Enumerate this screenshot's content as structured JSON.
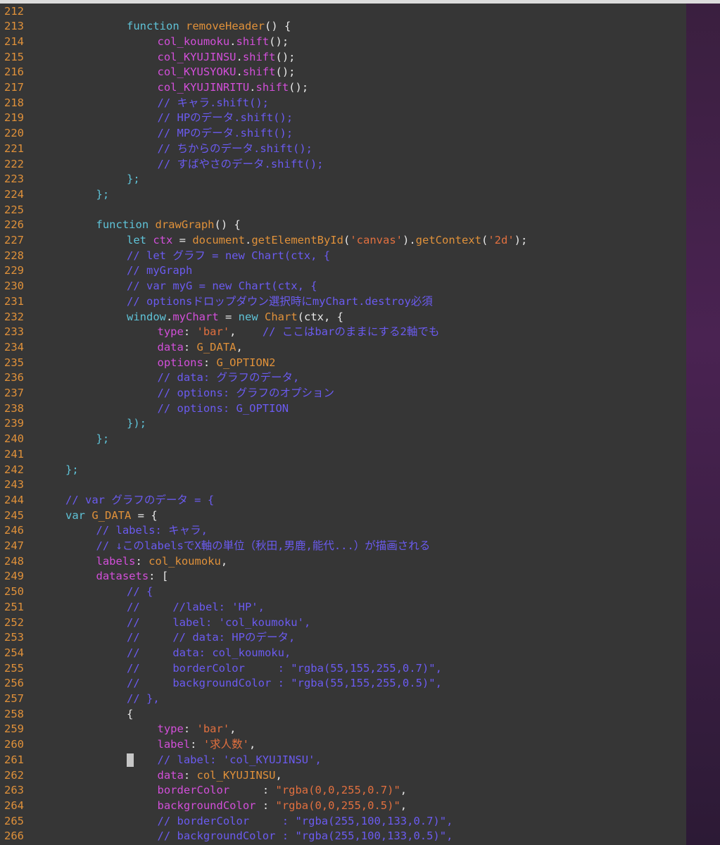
{
  "editor": {
    "language": "javascript",
    "lines": [
      {
        "num": "212",
        "indent": 0,
        "tokens": []
      },
      {
        "num": "213",
        "indent": 4,
        "tokens": [
          [
            "kw",
            "function "
          ],
          [
            "fn",
            "removeHeader"
          ],
          [
            "pun",
            "() {"
          ]
        ]
      },
      {
        "num": "214",
        "indent": 5,
        "tokens": [
          [
            "prop",
            "col_koumoku"
          ],
          [
            "pun",
            "."
          ],
          [
            "prop",
            "shift"
          ],
          [
            "pun",
            "();"
          ]
        ]
      },
      {
        "num": "215",
        "indent": 5,
        "tokens": [
          [
            "prop",
            "col_KYUJINSU"
          ],
          [
            "pun",
            "."
          ],
          [
            "prop",
            "shift"
          ],
          [
            "pun",
            "();"
          ]
        ]
      },
      {
        "num": "216",
        "indent": 5,
        "tokens": [
          [
            "prop",
            "col_KYUSYOKU"
          ],
          [
            "pun",
            "."
          ],
          [
            "prop",
            "shift"
          ],
          [
            "pun",
            "();"
          ]
        ]
      },
      {
        "num": "217",
        "indent": 5,
        "tokens": [
          [
            "prop",
            "col_KYUJINRITU"
          ],
          [
            "pun",
            "."
          ],
          [
            "prop",
            "shift"
          ],
          [
            "pun",
            "();"
          ]
        ]
      },
      {
        "num": "218",
        "indent": 5,
        "tokens": [
          [
            "cm",
            "// キャラ.shift();"
          ]
        ]
      },
      {
        "num": "219",
        "indent": 5,
        "tokens": [
          [
            "cm",
            "// HPのデータ.shift();"
          ]
        ]
      },
      {
        "num": "220",
        "indent": 5,
        "tokens": [
          [
            "cm",
            "// MPのデータ.shift();"
          ]
        ]
      },
      {
        "num": "221",
        "indent": 5,
        "tokens": [
          [
            "cm",
            "// ちからのデータ.shift();"
          ]
        ]
      },
      {
        "num": "222",
        "indent": 5,
        "tokens": [
          [
            "cm",
            "// すばやさのデータ.shift();"
          ]
        ]
      },
      {
        "num": "223",
        "indent": 4,
        "tokens": [
          [
            "kw",
            "};"
          ]
        ]
      },
      {
        "num": "224",
        "indent": 3,
        "tokens": [
          [
            "kw",
            "};"
          ]
        ]
      },
      {
        "num": "225",
        "indent": 0,
        "tokens": []
      },
      {
        "num": "226",
        "indent": 3,
        "tokens": [
          [
            "kw",
            "function "
          ],
          [
            "fn",
            "drawGraph"
          ],
          [
            "pun",
            "() {"
          ]
        ]
      },
      {
        "num": "227",
        "indent": 4,
        "tokens": [
          [
            "kw",
            "let "
          ],
          [
            "prop",
            "ctx"
          ],
          [
            "pun",
            " = "
          ],
          [
            "fn",
            "document"
          ],
          [
            "pun",
            "."
          ],
          [
            "fn",
            "getElementById"
          ],
          [
            "pun",
            "("
          ],
          [
            "str",
            "'canvas'"
          ],
          [
            "pun",
            ")."
          ],
          [
            "fn",
            "getContext"
          ],
          [
            "pun",
            "("
          ],
          [
            "str",
            "'2d'"
          ],
          [
            "pun",
            ");"
          ]
        ]
      },
      {
        "num": "228",
        "indent": 4,
        "tokens": [
          [
            "cm",
            "// let グラフ = new Chart(ctx, {"
          ]
        ]
      },
      {
        "num": "229",
        "indent": 4,
        "tokens": [
          [
            "cm",
            "// myGraph"
          ]
        ]
      },
      {
        "num": "230",
        "indent": 4,
        "tokens": [
          [
            "cm",
            "// var myG = new Chart(ctx, {"
          ]
        ]
      },
      {
        "num": "231",
        "indent": 4,
        "tokens": [
          [
            "cm",
            "// optionsドロップダウン選択時にmyChart.destroy必須"
          ]
        ]
      },
      {
        "num": "232",
        "indent": 4,
        "tokens": [
          [
            "kw",
            "window"
          ],
          [
            "pun",
            "."
          ],
          [
            "prop",
            "myChart"
          ],
          [
            "pun",
            " = "
          ],
          [
            "kw",
            "new "
          ],
          [
            "fn",
            "Chart"
          ],
          [
            "pun",
            "(ctx, {"
          ]
        ]
      },
      {
        "num": "233",
        "indent": 5,
        "tokens": [
          [
            "prop",
            "type"
          ],
          [
            "pun",
            ": "
          ],
          [
            "str",
            "'bar'"
          ],
          [
            "pun",
            ",    "
          ],
          [
            "cm",
            "// ここはbarのままにする2軸でも"
          ]
        ]
      },
      {
        "num": "234",
        "indent": 5,
        "tokens": [
          [
            "prop",
            "data"
          ],
          [
            "pun",
            ": "
          ],
          [
            "txt",
            "G_DATA"
          ],
          [
            "pun",
            ","
          ]
        ]
      },
      {
        "num": "235",
        "indent": 5,
        "tokens": [
          [
            "prop",
            "options"
          ],
          [
            "pun",
            ": "
          ],
          [
            "txt",
            "G_OPTION2"
          ]
        ]
      },
      {
        "num": "236",
        "indent": 5,
        "tokens": [
          [
            "cm",
            "// data: グラフのデータ,"
          ]
        ]
      },
      {
        "num": "237",
        "indent": 5,
        "tokens": [
          [
            "cm",
            "// options: グラフのオプション"
          ]
        ]
      },
      {
        "num": "238",
        "indent": 5,
        "tokens": [
          [
            "cm",
            "// options: G_OPTION"
          ]
        ]
      },
      {
        "num": "239",
        "indent": 4,
        "tokens": [
          [
            "kw",
            "});"
          ]
        ]
      },
      {
        "num": "240",
        "indent": 3,
        "tokens": [
          [
            "kw",
            "};"
          ]
        ]
      },
      {
        "num": "241",
        "indent": 0,
        "tokens": []
      },
      {
        "num": "242",
        "indent": 2,
        "tokens": [
          [
            "kw",
            "};"
          ]
        ]
      },
      {
        "num": "243",
        "indent": 0,
        "tokens": []
      },
      {
        "num": "244",
        "indent": 2,
        "tokens": [
          [
            "cm",
            "// var グラフのデータ = {"
          ]
        ]
      },
      {
        "num": "245",
        "indent": 2,
        "tokens": [
          [
            "kw",
            "var "
          ],
          [
            "txt",
            "G_DATA"
          ],
          [
            "pun",
            " = {"
          ]
        ]
      },
      {
        "num": "246",
        "indent": 3,
        "tokens": [
          [
            "cm",
            "// labels: キャラ,"
          ]
        ]
      },
      {
        "num": "247",
        "indent": 3,
        "tokens": [
          [
            "cm",
            "// ↓このlabelsでX軸の単位（秋田,男鹿,能代...）が描画される"
          ]
        ]
      },
      {
        "num": "248",
        "indent": 3,
        "tokens": [
          [
            "prop",
            "labels"
          ],
          [
            "pun",
            ": "
          ],
          [
            "txt",
            "col_koumoku"
          ],
          [
            "pun",
            ","
          ]
        ]
      },
      {
        "num": "249",
        "indent": 3,
        "tokens": [
          [
            "prop",
            "datasets"
          ],
          [
            "pun",
            ": ["
          ]
        ]
      },
      {
        "num": "250",
        "indent": 4,
        "tokens": [
          [
            "cm",
            "// {"
          ]
        ]
      },
      {
        "num": "251",
        "indent": 4,
        "tokens": [
          [
            "cm",
            "//     //label: 'HP',"
          ]
        ]
      },
      {
        "num": "252",
        "indent": 4,
        "tokens": [
          [
            "cm",
            "//     label: 'col_koumoku',"
          ]
        ]
      },
      {
        "num": "253",
        "indent": 4,
        "tokens": [
          [
            "cm",
            "//     // data: HPのデータ,"
          ]
        ]
      },
      {
        "num": "254",
        "indent": 4,
        "tokens": [
          [
            "cm",
            "//     data: col_koumoku,"
          ]
        ]
      },
      {
        "num": "255",
        "indent": 4,
        "tokens": [
          [
            "cm",
            "//     borderColor     : \"rgba(55,155,255,0.7)\","
          ]
        ]
      },
      {
        "num": "256",
        "indent": 4,
        "tokens": [
          [
            "cm",
            "//     backgroundColor : \"rgba(55,155,255,0.5)\","
          ]
        ]
      },
      {
        "num": "257",
        "indent": 4,
        "tokens": [
          [
            "cm",
            "// },"
          ]
        ]
      },
      {
        "num": "258",
        "indent": 4,
        "tokens": [
          [
            "pun",
            "{"
          ]
        ]
      },
      {
        "num": "259",
        "indent": 5,
        "tokens": [
          [
            "prop",
            "type"
          ],
          [
            "pun",
            ": "
          ],
          [
            "str",
            "'bar'"
          ],
          [
            "pun",
            ","
          ]
        ]
      },
      {
        "num": "260",
        "indent": 5,
        "tokens": [
          [
            "prop",
            "label"
          ],
          [
            "pun",
            ": "
          ],
          [
            "str",
            "'求人数'"
          ],
          [
            "pun",
            ","
          ]
        ]
      },
      {
        "num": "261",
        "indent": 5,
        "tokens": [
          [
            "cm",
            "// label: 'col_KYUJINSU',"
          ]
        ]
      },
      {
        "num": "262",
        "indent": 5,
        "tokens": [
          [
            "prop",
            "data"
          ],
          [
            "pun",
            ": "
          ],
          [
            "txt",
            "col_KYUJINSU"
          ],
          [
            "pun",
            ","
          ]
        ]
      },
      {
        "num": "263",
        "indent": 5,
        "tokens": [
          [
            "prop",
            "borderColor"
          ],
          [
            "pun",
            "     : "
          ],
          [
            "str",
            "\"rgba(0,0,255,0.7)\""
          ],
          [
            "pun",
            ","
          ]
        ]
      },
      {
        "num": "264",
        "indent": 5,
        "tokens": [
          [
            "prop",
            "backgroundColor"
          ],
          [
            "pun",
            " : "
          ],
          [
            "str",
            "\"rgba(0,0,255,0.5)\""
          ],
          [
            "pun",
            ","
          ]
        ]
      },
      {
        "num": "265",
        "indent": 5,
        "tokens": [
          [
            "cm",
            "// borderColor     : \"rgba(255,100,133,0.7)\","
          ]
        ]
      },
      {
        "num": "266",
        "indent": 5,
        "tokens": [
          [
            "cm",
            "// backgroundColor : \"rgba(255,100,133,0.5)\","
          ]
        ]
      }
    ],
    "cursor_line": "261"
  },
  "colors": {
    "background": "#363636",
    "line_number": "#e0913a",
    "keyword": "#5fc3d8",
    "comment": "#6b5bf0",
    "property": "#d24fd9",
    "string": "#e2703f"
  }
}
